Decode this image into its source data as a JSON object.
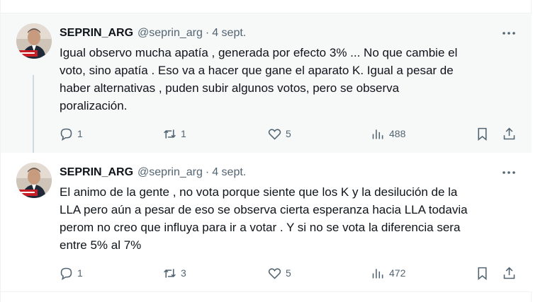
{
  "tweets": [
    {
      "name": "SEPRIN_ARG",
      "handle": "@seprin_arg",
      "separator": "·",
      "date": "4 sept.",
      "text_lines": [
        "Igual observo mucha apatía , generada por efecto 3% ... No que cambie el",
        "voto, sino apatía . Eso va a hacer que gane el aparato K. Igual a pesar de",
        "haber alternativas , puden subir algunos votos, pero se observa",
        "poralización."
      ],
      "replies": "1",
      "retweets": "1",
      "likes": "5",
      "views": "488"
    },
    {
      "name": "SEPRIN_ARG",
      "handle": "@seprin_arg",
      "separator": "·",
      "date": "4 sept.",
      "text_lines": [
        "El animo de la gente , no vota porque  siente que los K y la desilución de la",
        "LLA pero aún a pesar de eso se observa cierta esperanza hacia LLA todavia",
        "perom no creo que influya para ir a votar . Y si no se vota la diferencia sera",
        "entre 5% al 7%"
      ],
      "replies": "1",
      "retweets": "3",
      "likes": "5",
      "views": "472"
    }
  ],
  "icons": [
    "more-icon",
    "reply-icon",
    "retweet-icon",
    "like-icon",
    "views-icon",
    "bookmark-icon",
    "share-icon"
  ],
  "colors": {
    "secondary_text": "#536471",
    "thread_line": "#cfd9de",
    "highlight_bg": "#f7f9f9"
  }
}
